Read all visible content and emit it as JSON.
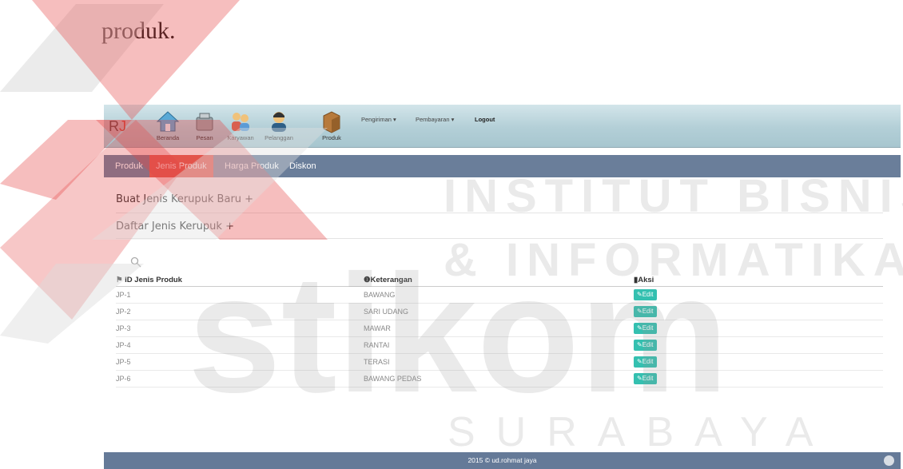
{
  "document_text": "produk.",
  "app": {
    "brand": "R",
    "brand_accent": "J"
  },
  "nav_icons": [
    {
      "label": "Beranda",
      "icon": "home-icon"
    },
    {
      "label": "Pesan",
      "icon": "order-icon"
    },
    {
      "label": "Karyawan",
      "icon": "employees-icon"
    },
    {
      "label": "Pelanggan",
      "icon": "customer-icon"
    },
    {
      "label": "Produk",
      "icon": "product-box-icon"
    }
  ],
  "dropdowns": [
    {
      "label": "Pengiriman ▾"
    },
    {
      "label": "Pembayaran ▾"
    }
  ],
  "logout": "Logout",
  "subnav": [
    {
      "label": "Produk",
      "active": false
    },
    {
      "label": "Jenis Produk",
      "active": true
    },
    {
      "label": "Harga Produk",
      "active": false
    },
    {
      "label": "Diskon",
      "active": false
    }
  ],
  "content": {
    "create_link": "Buat Jenis Kerupuk Baru +",
    "list_link": "Daftar Jenis Kerupuk +",
    "table": {
      "headers": [
        "ID Jenis Produk",
        "Keterangan",
        "Aksi"
      ],
      "rows": [
        {
          "id": "JP-1",
          "ket": "BAWANG",
          "action": "Edit"
        },
        {
          "id": "JP-2",
          "ket": "SARI UDANG",
          "action": "Edit"
        },
        {
          "id": "JP-3",
          "ket": "MAWAR",
          "action": "Edit"
        },
        {
          "id": "JP-4",
          "ket": "RANTAI",
          "action": "Edit"
        },
        {
          "id": "JP-5",
          "ket": "TERASI",
          "action": "Edit"
        },
        {
          "id": "JP-6",
          "ket": "BAWANG PEDAS",
          "action": "Edit"
        }
      ]
    }
  },
  "footer": "2015 © ud.rohmat jaya",
  "watermark": {
    "line1": "INSTITUT BISNIS",
    "line2": "& INFORMATIKA",
    "line3": "stikom",
    "line4": "SURABAYA"
  },
  "colors": {
    "subnav_bg": "#6a7e9a",
    "active_tab": "#e25c4f",
    "edit_button": "#34c0b0",
    "footer_bg": "#657a98"
  }
}
